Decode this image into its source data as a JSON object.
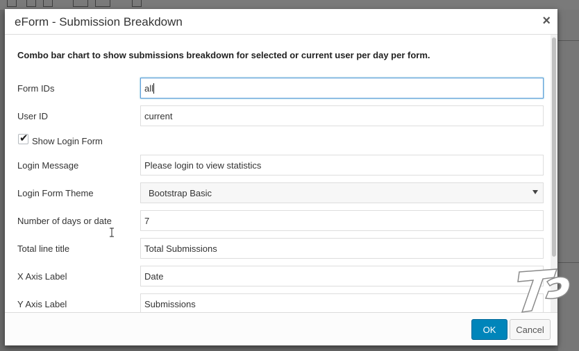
{
  "modal": {
    "title": "eForm - Submission Breakdown",
    "close_label": "×",
    "intro": "Combo bar chart to show submissions breakdown for selected or current user per day per form."
  },
  "fields": {
    "form_ids": {
      "label": "Form IDs",
      "value": "all"
    },
    "user_id": {
      "label": "User ID",
      "value": "current"
    },
    "show_login_form": {
      "label": "Show Login Form",
      "checked": true
    },
    "login_message": {
      "label": "Login Message",
      "value": "Please login to view statistics"
    },
    "login_form_theme": {
      "label": "Login Form Theme",
      "selected": "Bootstrap Basic"
    },
    "number_of_days": {
      "label": "Number of days or date",
      "value": "7"
    },
    "total_line_title": {
      "label": "Total line title",
      "value": "Total Submissions"
    },
    "x_axis_label": {
      "label": "X Axis Label",
      "value": "Date"
    },
    "y_axis_label": {
      "label": "Y Axis Label",
      "value": "Submissions"
    }
  },
  "footer": {
    "ok_label": "OK",
    "cancel_label": "Cancel"
  },
  "colors": {
    "primary_button": "#0085ba",
    "focus_border": "#5b9dd9"
  },
  "icons": {
    "close": "close-icon",
    "checkmark": "checkmark-icon",
    "dropdown": "chevron-down-icon",
    "watermark": "watermark-logo"
  }
}
